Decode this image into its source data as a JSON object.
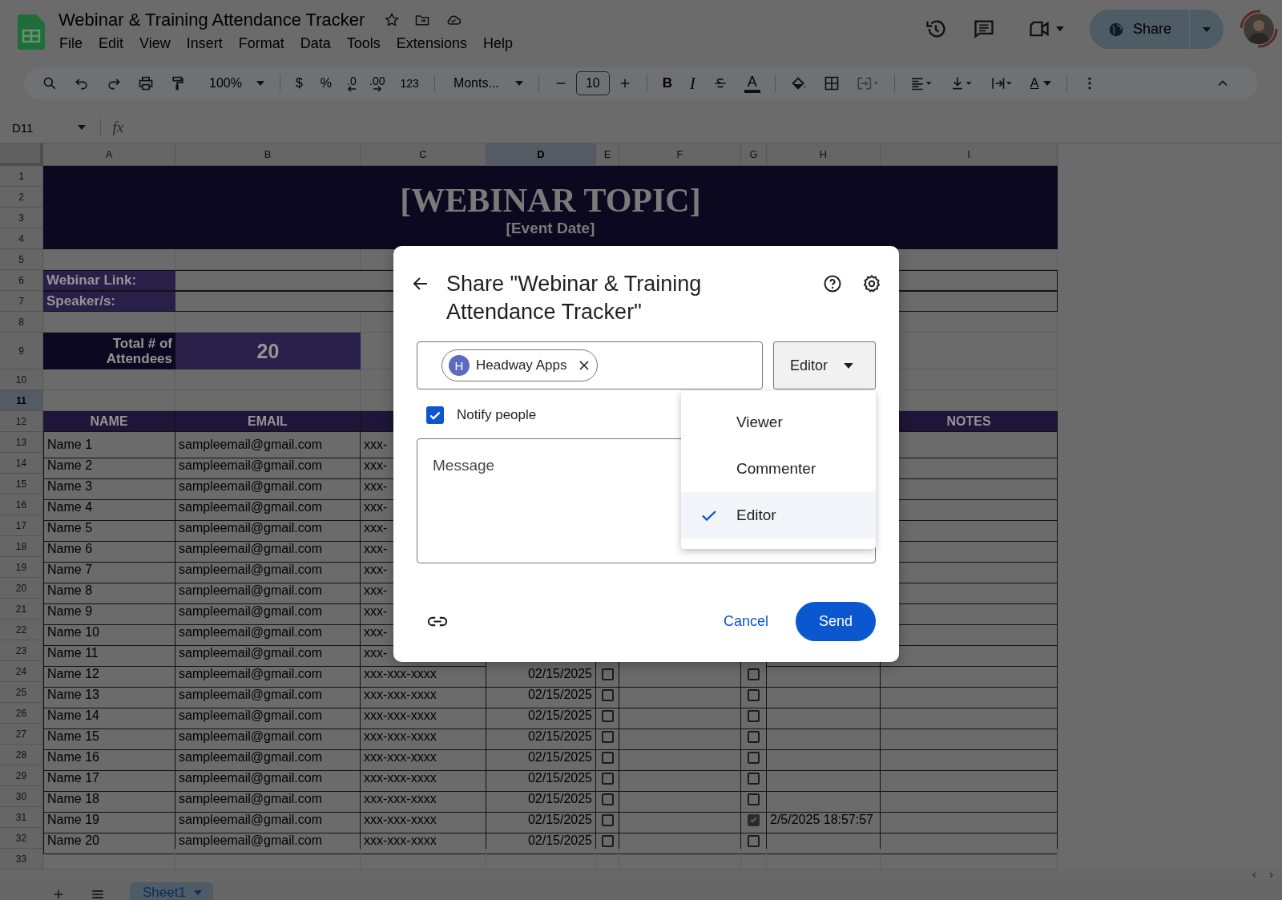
{
  "app": {
    "title": "Webinar & Training Attendance Tracker",
    "menu": [
      "File",
      "Edit",
      "View",
      "Insert",
      "Format",
      "Data",
      "Tools",
      "Extensions",
      "Help"
    ],
    "share_label": "Share"
  },
  "toolbar": {
    "zoom": "100%",
    "currency": "$",
    "percent": "%",
    "decrease_decimals": ".0",
    "increase_decimals": ".00",
    "number_format": "123",
    "font": "Monts...",
    "font_size": "10",
    "bold": "B",
    "italic": "I",
    "text_color": "A",
    "text_rotation": "A"
  },
  "formula_bar": {
    "cell": "D11",
    "formula_label": "fx"
  },
  "sheet": {
    "columns": [
      {
        "label": "A",
        "selected": false
      },
      {
        "label": "B",
        "selected": false
      },
      {
        "label": "C",
        "selected": false
      },
      {
        "label": "D",
        "selected": true
      },
      {
        "label": "E",
        "selected": false
      },
      {
        "label": "F",
        "selected": false
      },
      {
        "label": "G",
        "selected": false
      },
      {
        "label": "H",
        "selected": false
      },
      {
        "label": "I",
        "selected": false
      }
    ],
    "row_headers": [
      {
        "label": "1",
        "selected": false
      },
      {
        "label": "2",
        "selected": false
      },
      {
        "label": "3",
        "selected": false
      },
      {
        "label": "4",
        "selected": false
      },
      {
        "label": "5",
        "selected": false
      },
      {
        "label": "6",
        "selected": false
      },
      {
        "label": "7",
        "selected": false
      },
      {
        "label": "8",
        "selected": false
      },
      {
        "label": "9",
        "selected": false
      },
      {
        "label": "10",
        "selected": false
      },
      {
        "label": "11",
        "selected": true
      },
      {
        "label": "12",
        "selected": false
      },
      {
        "label": "13",
        "selected": false
      },
      {
        "label": "14",
        "selected": false
      },
      {
        "label": "15",
        "selected": false
      },
      {
        "label": "16",
        "selected": false
      },
      {
        "label": "17",
        "selected": false
      },
      {
        "label": "18",
        "selected": false
      },
      {
        "label": "19",
        "selected": false
      },
      {
        "label": "20",
        "selected": false
      },
      {
        "label": "21",
        "selected": false
      },
      {
        "label": "22",
        "selected": false
      },
      {
        "label": "23",
        "selected": false
      },
      {
        "label": "24",
        "selected": false
      },
      {
        "label": "25",
        "selected": false
      },
      {
        "label": "26",
        "selected": false
      },
      {
        "label": "27",
        "selected": false
      },
      {
        "label": "28",
        "selected": false
      },
      {
        "label": "29",
        "selected": false
      },
      {
        "label": "30",
        "selected": false
      },
      {
        "label": "31",
        "selected": false
      },
      {
        "label": "32",
        "selected": false
      },
      {
        "label": "33",
        "selected": false
      }
    ],
    "banner": {
      "title": "[WEBINAR TOPIC]",
      "subtitle": "[Event Date]"
    },
    "info_labels": [
      "Webinar Link:",
      "Speaker/s:"
    ],
    "total": {
      "label": "Total # of Attendees",
      "value": "20"
    },
    "table_header": {
      "name": "NAME",
      "email": "EMAIL",
      "notes": "NOTES"
    },
    "rows": [
      {
        "name": "Name 1",
        "email": "sampleemail@gmail.com",
        "phone": "xxx-"
      },
      {
        "name": "Name 2",
        "email": "sampleemail@gmail.com",
        "phone": "xxx-"
      },
      {
        "name": "Name 3",
        "email": "sampleemail@gmail.com",
        "phone": "xxx-"
      },
      {
        "name": "Name 4",
        "email": "sampleemail@gmail.com",
        "phone": "xxx-"
      },
      {
        "name": "Name 5",
        "email": "sampleemail@gmail.com",
        "phone": "xxx-"
      },
      {
        "name": "Name 6",
        "email": "sampleemail@gmail.com",
        "phone": "xxx-"
      },
      {
        "name": "Name 7",
        "email": "sampleemail@gmail.com",
        "phone": "xxx-"
      },
      {
        "name": "Name 8",
        "email": "sampleemail@gmail.com",
        "phone": "xxx-"
      },
      {
        "name": "Name 9",
        "email": "sampleemail@gmail.com",
        "phone": "xxx-"
      },
      {
        "name": "Name 10",
        "email": "sampleemail@gmail.com",
        "phone": "xxx-"
      },
      {
        "name": "Name 11",
        "email": "sampleemail@gmail.com",
        "phone": "xxx-"
      },
      {
        "name": "Name 12",
        "email": "sampleemail@gmail.com",
        "phone": "xxx-xxx-xxxx",
        "date": "02/15/2025",
        "column_e_checked": false,
        "column_g_checked": false
      },
      {
        "name": "Name 13",
        "email": "sampleemail@gmail.com",
        "phone": "xxx-xxx-xxxx",
        "date": "02/15/2025",
        "column_e_checked": false,
        "column_g_checked": false
      },
      {
        "name": "Name 14",
        "email": "sampleemail@gmail.com",
        "phone": "xxx-xxx-xxxx",
        "date": "02/15/2025",
        "column_e_checked": false,
        "column_g_checked": false
      },
      {
        "name": "Name 15",
        "email": "sampleemail@gmail.com",
        "phone": "xxx-xxx-xxxx",
        "date": "02/15/2025",
        "column_e_checked": false,
        "column_g_checked": false
      },
      {
        "name": "Name 16",
        "email": "sampleemail@gmail.com",
        "phone": "xxx-xxx-xxxx",
        "date": "02/15/2025",
        "column_e_checked": false,
        "column_g_checked": false
      },
      {
        "name": "Name 17",
        "email": "sampleemail@gmail.com",
        "phone": "xxx-xxx-xxxx",
        "date": "02/15/2025",
        "column_e_checked": false,
        "column_g_checked": false
      },
      {
        "name": "Name 18",
        "email": "sampleemail@gmail.com",
        "phone": "xxx-xxx-xxxx",
        "date": "02/15/2025",
        "column_e_checked": false,
        "column_g_checked": false
      },
      {
        "name": "Name 19",
        "email": "sampleemail@gmail.com",
        "phone": "xxx-xxx-xxxx",
        "date": "02/15/2025",
        "column_e_checked": false,
        "column_g_checked": true,
        "column_h": "2/5/2025 18:57:57"
      },
      {
        "name": "Name 20",
        "email": "sampleemail@gmail.com",
        "phone": "xxx-xxx-xxxx",
        "date": "02/15/2025",
        "column_e_checked": false,
        "column_g_checked": false
      }
    ]
  },
  "sheets": [
    {
      "label": "Sheet1",
      "selected": true
    }
  ],
  "share_dialog": {
    "title": "Share \"Webinar & Training Attendance Tracker\"",
    "recipient": {
      "initial": "H",
      "name": "Headway Apps"
    },
    "role": "Editor",
    "notify": {
      "label": "Notify people",
      "checked": true
    },
    "message": {
      "placeholder": "Message"
    },
    "cancel": "Cancel",
    "send": "Send",
    "role_menu": [
      {
        "label": "Viewer",
        "selected": false
      },
      {
        "label": "Commenter",
        "selected": false
      },
      {
        "label": "Editor",
        "selected": true
      }
    ]
  }
}
